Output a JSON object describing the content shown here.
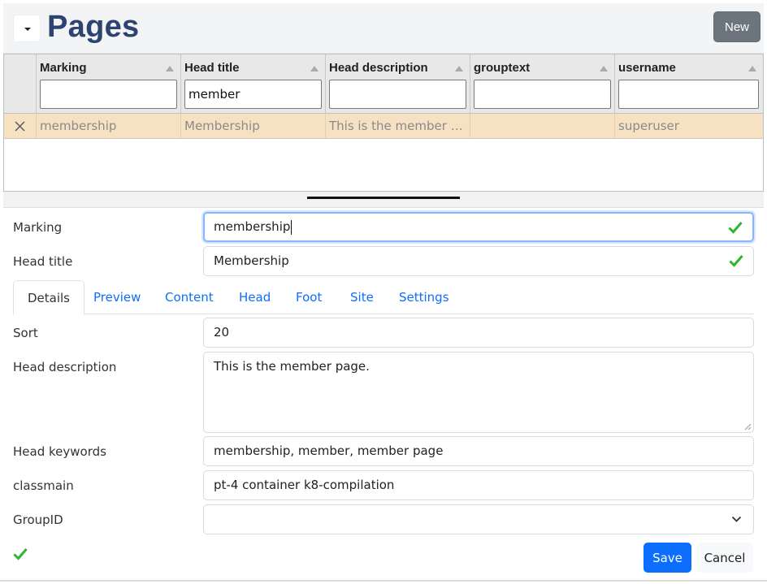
{
  "header": {
    "title": "Pages",
    "new_label": "New"
  },
  "grid": {
    "columns": [
      {
        "title": "Marking",
        "filter": ""
      },
      {
        "title": "Head title",
        "filter": "member"
      },
      {
        "title": "Head description",
        "filter": ""
      },
      {
        "title": "grouptext",
        "filter": ""
      },
      {
        "title": "username",
        "filter": ""
      }
    ],
    "rows": [
      {
        "marking": "membership",
        "head_title": "Membership",
        "head_description": "This is the member page.",
        "grouptext": "",
        "username": "superuser"
      }
    ]
  },
  "form": {
    "marking": {
      "label": "Marking",
      "value": "membership"
    },
    "head_title": {
      "label": "Head title",
      "value": "Membership"
    },
    "tabs": [
      "Details",
      "Preview",
      "Content",
      "Head",
      "Foot",
      "Site",
      "Settings"
    ],
    "active_tab": "Details",
    "sort": {
      "label": "Sort",
      "value": "20"
    },
    "head_description": {
      "label": "Head description",
      "value": "This is the member page."
    },
    "head_keywords": {
      "label": "Head keywords",
      "value": "membership, member, member page"
    },
    "classmain": {
      "label": "classmain",
      "value": "pt-4 container k8-compilation"
    },
    "groupid": {
      "label": "GroupID",
      "value": ""
    }
  },
  "actions": {
    "save_label": "Save",
    "cancel_label": "Cancel"
  },
  "colors": {
    "accent": "#0d6efd",
    "row_selected": "#f7e1c3",
    "title": "#2d4470",
    "valid": "#2fb52f"
  }
}
